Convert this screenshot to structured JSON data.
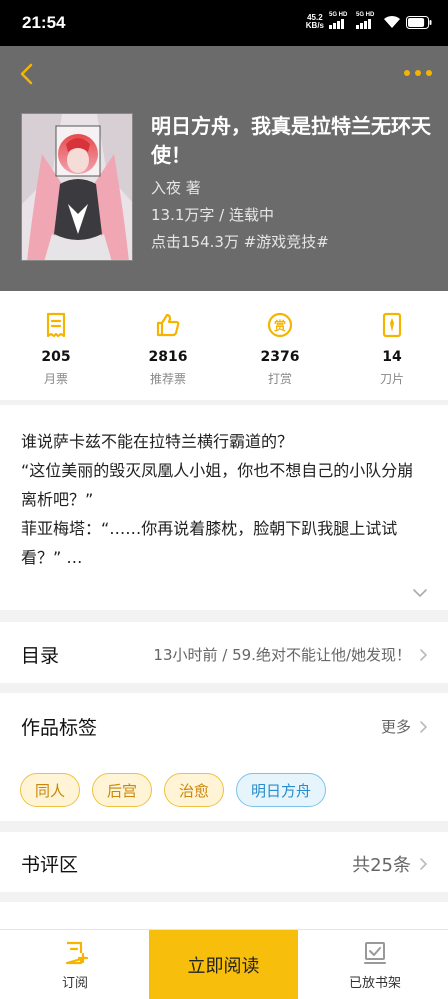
{
  "status_bar": {
    "time": "21:54",
    "net_speed_value": "45.2",
    "net_speed_unit": "KB/s",
    "sim1_label": "5G HD",
    "sim2_label": "5G HD",
    "battery_level": 0.85
  },
  "header": {
    "back_icon": "chevron-left-icon",
    "more_icon": "more-dots-icon",
    "accent": "#f5b400"
  },
  "book": {
    "title": "明日方舟，我真是拉特兰无环天使！",
    "author": "入夜  著",
    "words_status": "13.1万字 / 连载中",
    "clicks_tag": "点击154.3万 #游戏竞技#"
  },
  "stats": [
    {
      "icon": "monthly-ticket-icon",
      "value": "205",
      "label": "月票"
    },
    {
      "icon": "thumbs-up-icon",
      "value": "2816",
      "label": "推荐票"
    },
    {
      "icon": "reward-coin-icon",
      "value": "2376",
      "label": "打赏"
    },
    {
      "icon": "blade-card-icon",
      "value": "14",
      "label": "刀片"
    }
  ],
  "intro": {
    "lines": [
      "谁说萨卡兹不能在拉特兰横行霸道的？",
      "“这位美丽的毁灭凤凰人小姐，你也不想自己的小队分崩离析吧？”",
      "菲亚梅塔：“……你再说着膝枕，脸朝下趴我腿上试试看？” …"
    ]
  },
  "toc": {
    "title": "目录",
    "latest": "13小时前 / 59.绝对不能让他/她发现！"
  },
  "tags_section": {
    "title": "作品标签",
    "more": "更多",
    "tags": [
      "同人",
      "后宫",
      "治愈",
      "明日方舟"
    ]
  },
  "reviews": {
    "title": "书评区",
    "count": "共25条"
  },
  "bottom_bar": {
    "subscribe": "订阅",
    "read_now": "立即阅读",
    "on_shelf": "已放书架"
  }
}
